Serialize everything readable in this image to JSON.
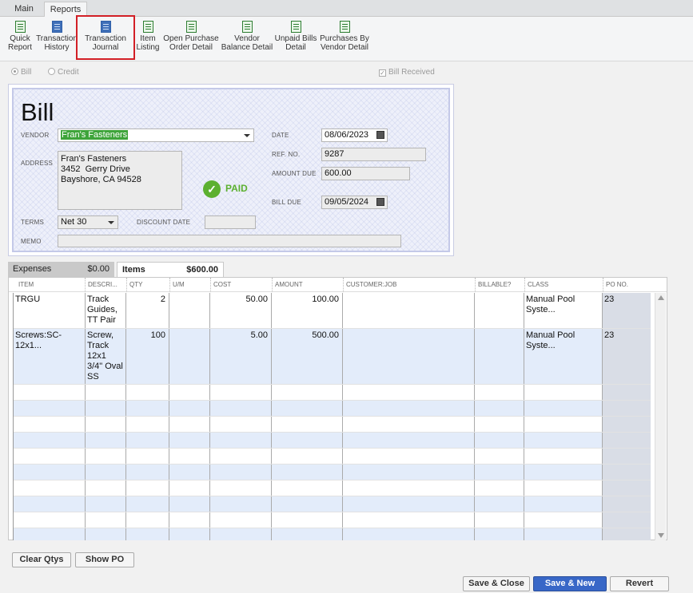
{
  "tabs": [
    "Main",
    "Reports"
  ],
  "ribbon": [
    {
      "l1": "Quick",
      "l2": "Report",
      "icon": "quick-report-icon"
    },
    {
      "l1": "Transaction",
      "l2": "History",
      "icon": "transaction-history-icon"
    },
    {
      "l1": "Transaction",
      "l2": "Journal",
      "icon": "transaction-journal-icon"
    },
    {
      "l1": "Item",
      "l2": "Listing",
      "icon": "item-listing-icon"
    },
    {
      "l1": "Open Purchase",
      "l2": "Order Detail",
      "icon": "open-purchase-icon"
    },
    {
      "l1": "Vendor",
      "l2": "Balance Detail",
      "icon": "vendor-balance-icon"
    },
    {
      "l1": "Unpaid Bills",
      "l2": "Detail",
      "icon": "unpaid-bills-icon"
    },
    {
      "l1": "Purchases By",
      "l2": "Vendor Detail",
      "icon": "purchases-by-vendor-icon"
    }
  ],
  "options": {
    "bill": "Bill",
    "credit": "Credit",
    "bill_received": "Bill Received"
  },
  "form": {
    "title": "Bill",
    "vendor_label": "VENDOR",
    "vendor": "Fran's Fasteners",
    "address_label": "ADDRESS",
    "address": [
      "Fran's Fasteners",
      "3452  Gerry Drive",
      "Bayshore, CA 94528"
    ],
    "date_label": "DATE",
    "date": "08/06/2023",
    "ref_label": "REF. NO.",
    "ref": "9287",
    "amount_due_label": "AMOUNT DUE",
    "amount_due": "600.00",
    "bill_due_label": "BILL DUE",
    "bill_due": "09/05/2024",
    "terms_label": "TERMS",
    "terms": "Net 30",
    "discount_label": "DISCOUNT DATE",
    "discount": "",
    "memo_label": "MEMO",
    "memo": "",
    "paid": "PAID"
  },
  "grid_tabs": {
    "expenses": "Expenses",
    "expenses_amt": "$0.00",
    "items": "Items",
    "items_amt": "$600.00"
  },
  "columns": [
    "ITEM",
    "DESCRI...",
    "QTY",
    "U/M",
    "COST",
    "AMOUNT",
    "CUSTOMER:JOB",
    "BILLABLE?",
    "CLASS",
    "PO NO."
  ],
  "rows": [
    {
      "item": "TRGU",
      "desc": "Track Guides, TT Pair",
      "qty": "2",
      "um": "",
      "cost": "50.00",
      "amount": "100.00",
      "job": "",
      "billable": "",
      "class": "Manual Pool Syste...",
      "po": "23"
    },
    {
      "item": "Screws:SC-12x1...",
      "desc": "Screw, Track 12x1 3/4\" Oval SS",
      "qty": "100",
      "um": "",
      "cost": "5.00",
      "amount": "500.00",
      "job": "",
      "billable": "",
      "class": "Manual Pool Syste...",
      "po": "23"
    }
  ],
  "buttons": {
    "clear_qtys": "Clear Qtys",
    "show_po": "Show PO",
    "save_close": "Save & Close",
    "save_new": "Save & New",
    "revert": "Revert"
  }
}
